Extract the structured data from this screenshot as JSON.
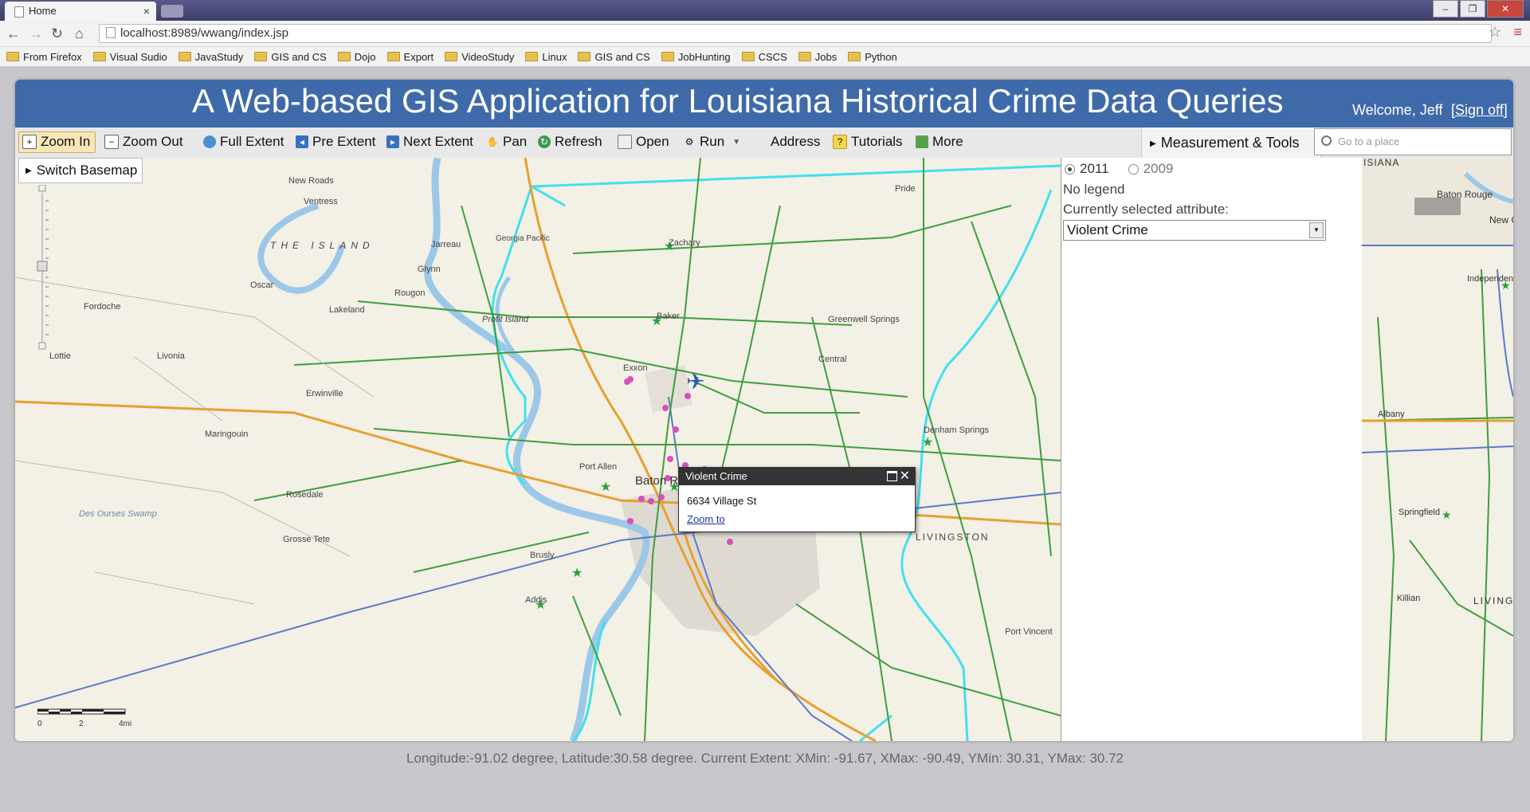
{
  "browser": {
    "tab_title": "Home",
    "tab_close": "×",
    "url": "localhost:8989/wwang/index.jsp",
    "bookmarks": [
      "From Firefox",
      "Visual Sudio",
      "JavaStudy",
      "GIS and CS",
      "Dojo",
      "Export",
      "VideoStudy",
      "Linux",
      "GIS and CS",
      "JobHunting",
      "CSCS",
      "Jobs",
      "Python"
    ]
  },
  "header": {
    "title": "A Web-based GIS Application for Louisiana Historical Crime Data Queries",
    "welcome": "Welcome, Jeff",
    "signout": "[Sign off]"
  },
  "toolbar": {
    "zoom_in": "Zoom In",
    "zoom_out": "Zoom Out",
    "full_extent": "Full Extent",
    "pre_extent": "Pre Extent",
    "next_extent": "Next Extent",
    "pan": "Pan",
    "refresh": "Refresh",
    "open": "Open",
    "run": "Run",
    "address": "Address",
    "tutorials": "Tutorials",
    "more": "More",
    "measurement": "Measurement & Tools",
    "search_placeholder": "Go to a place"
  },
  "map": {
    "switch_basemap": "Switch Basemap",
    "popup": {
      "title": "Violent Crime",
      "address": "6634 Village St",
      "zoom_link": "Zoom to"
    },
    "scale_labels": [
      "0",
      "2",
      "4mi"
    ],
    "place_labels": [
      "New Roads",
      "Ventress",
      "THE ISLAND",
      "Jarreau",
      "Georgia Pacific",
      "Zachary",
      "Pride",
      "Glynn",
      "Oscar",
      "Rougon",
      "Fordoche",
      "Lakeland",
      "Profit Island",
      "Baker",
      "Greenwell Springs",
      "Lottie",
      "Livonia",
      "Exxon",
      "Central",
      "Erwinville",
      "Maringouin",
      "Denham Springs",
      "Port Allen",
      "Baton Rouge",
      "Rosedale",
      "Grosse Tete",
      "Brusly",
      "Addis",
      "Des Ourses Swamp",
      "LIVINGSTON",
      "Port Vincent"
    ]
  },
  "legend": {
    "years": [
      {
        "label": "2011",
        "selected": true
      },
      {
        "label": "2009",
        "selected": false
      }
    ],
    "no_legend": "No legend",
    "attr_label": "Currently selected attribute:",
    "attr_value": "Violent Crime"
  },
  "overview": {
    "labels": [
      "ISIANA",
      "Baton Rouge",
      "New Orlea",
      "Independence",
      "Albany",
      "Springfield",
      "LIVINGSTON",
      "Killian"
    ]
  },
  "statusbar": "Longitude:-91.02 degree, Latitude:30.58 degree. Current Extent: XMin: -91.67, XMax: -90.49, YMin: 30.31, YMax: 30.72",
  "colors": {
    "header": "#3f6aaa",
    "parish_boundary": "#40e0f0",
    "crime_point": "#d64fbf",
    "road_green": "#3e9e3e",
    "highway": "#e6a030",
    "river": "#9cc8e8"
  }
}
